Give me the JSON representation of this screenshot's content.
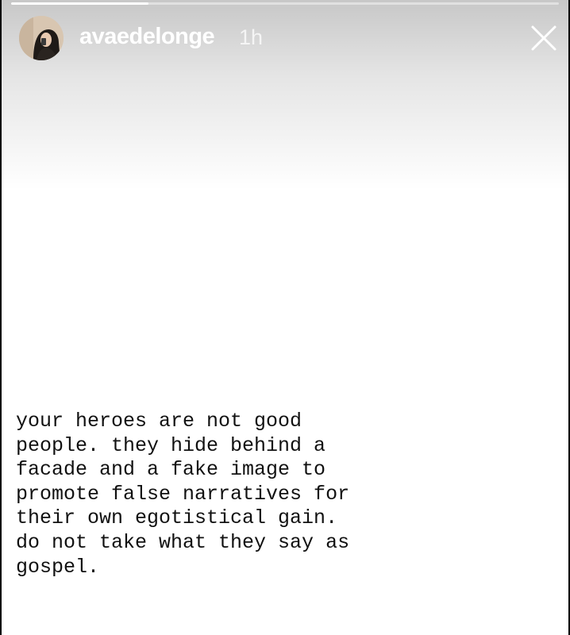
{
  "story": {
    "progress": 0.25,
    "user": {
      "username": "avaedelonge",
      "time_ago": "1h",
      "avatar_icon": "profile-photo"
    },
    "close_icon": "close-x",
    "text": "your heroes are not good\npeople. they hide behind a\nfacade and a fake image to\npromote false narratives for\ntheir own egotistical gain.\ndo not take what they say as\ngospel."
  },
  "colors": {
    "background": "#ffffff",
    "text": "#111111",
    "header_text": "#ffffff"
  }
}
